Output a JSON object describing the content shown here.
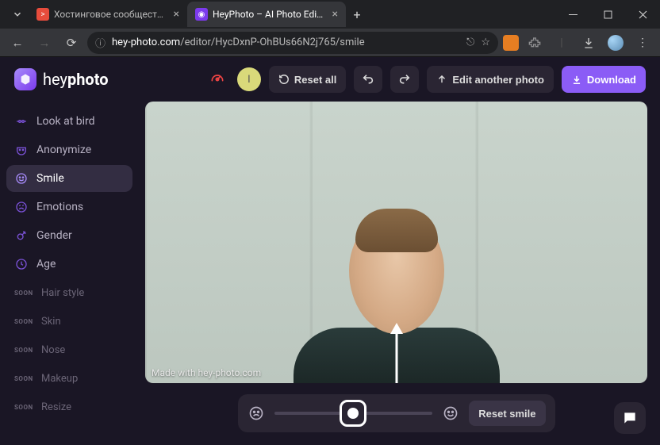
{
  "browser": {
    "tabs": [
      {
        "title": "Хостинговое сообщество «Tim",
        "favicon_color": "#e74c3c",
        "active": false
      },
      {
        "title": "HeyPhoto – AI Photo Editor On…",
        "favicon_color": "#7c3aed",
        "active": true
      }
    ],
    "url_display": "hey-photo.com/editor/HycDxnP-OhBUs66N2j765/smile",
    "url_domain": "hey-photo.com"
  },
  "app": {
    "logo": {
      "brand_light": "hey",
      "brand_bold": "photo"
    },
    "header": {
      "user_initial": "I",
      "reset_all": "Reset all",
      "edit_another": "Edit another photo",
      "download": "Download"
    },
    "sidebar": {
      "items": [
        {
          "icon": "bird",
          "label": "Look at bird",
          "active": false
        },
        {
          "icon": "mask",
          "label": "Anonymize",
          "active": false
        },
        {
          "icon": "smile",
          "label": "Smile",
          "active": true
        },
        {
          "icon": "emotion",
          "label": "Emotions",
          "active": false
        },
        {
          "icon": "gender",
          "label": "Gender",
          "active": false
        },
        {
          "icon": "age",
          "label": "Age",
          "active": false
        }
      ],
      "soon_label": "SOON",
      "soon_items": [
        {
          "label": "Hair style"
        },
        {
          "label": "Skin"
        },
        {
          "label": "Nose"
        },
        {
          "label": "Makeup"
        },
        {
          "label": "Resize"
        }
      ]
    },
    "canvas": {
      "watermark": "Made with hey-photo.com"
    },
    "controls": {
      "slider_value": 50,
      "reset_label": "Reset smile"
    }
  }
}
